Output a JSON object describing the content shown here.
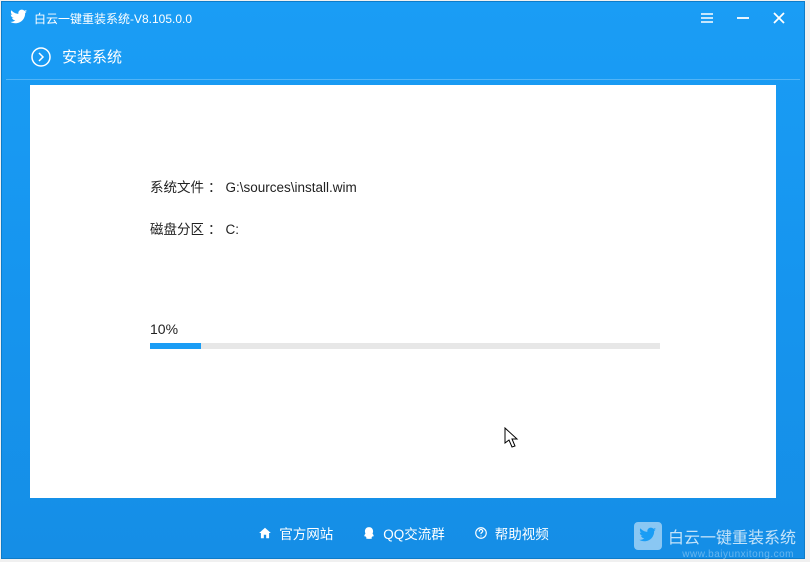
{
  "titlebar": {
    "title": "白云一键重装系统-V8.105.0.0"
  },
  "header": {
    "step_label": "安装系统"
  },
  "install": {
    "file_label": "系统文件",
    "file_value": "G:\\sources\\install.wim",
    "partition_label": "磁盘分区",
    "partition_value": "C:",
    "progress_percent_text": "10%",
    "progress_percent_value": 10
  },
  "footer": {
    "official_site": "官方网站",
    "qq_group": "QQ交流群",
    "help_video": "帮助视频"
  },
  "watermark": {
    "brand": "白云一键重装系统",
    "url": "www.baiyunxitong.com"
  }
}
